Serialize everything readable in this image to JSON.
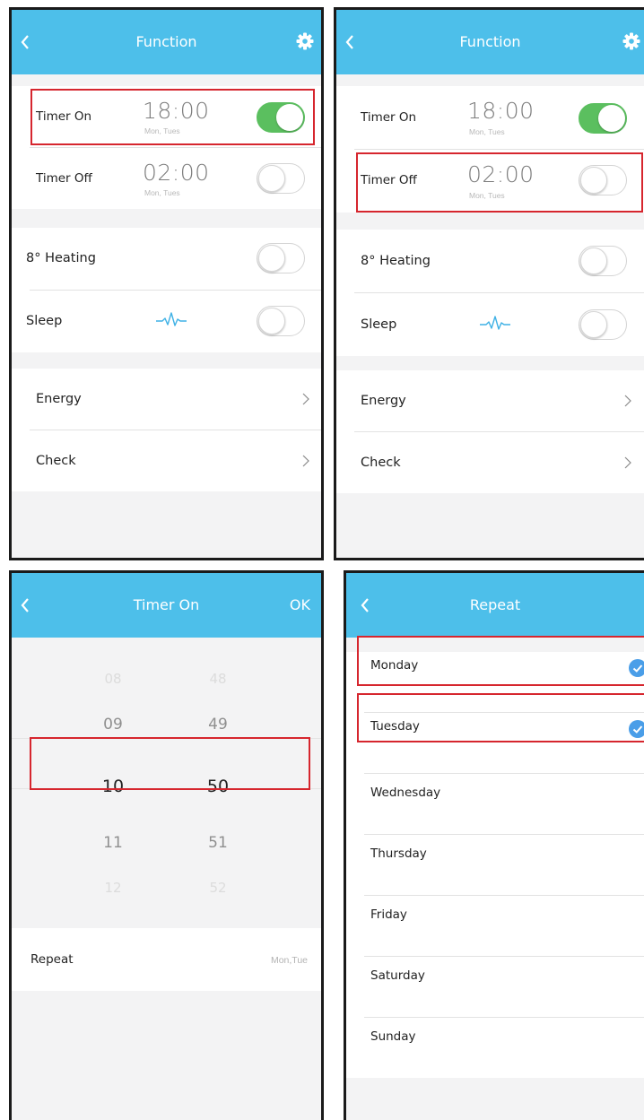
{
  "function_screen": {
    "title": "Function",
    "timer_on": {
      "label": "Timer On",
      "time": "18:00",
      "days": "Mon, Tues",
      "enabled": true
    },
    "timer_off": {
      "label": "Timer Off",
      "time": "02:00",
      "days": "Mon, Tues",
      "enabled": false
    },
    "heating": {
      "label": "8° Heating",
      "enabled": false
    },
    "sleep": {
      "label": "Sleep",
      "enabled": false
    },
    "energy": {
      "label": "Energy"
    },
    "check": {
      "label": "Check"
    }
  },
  "timer_screen": {
    "title": "Timer On",
    "ok_label": "OK",
    "hours": [
      "08",
      "09",
      "10",
      "11",
      "12"
    ],
    "minutes": [
      "48",
      "49",
      "50",
      "51",
      "52"
    ],
    "repeat_label": "Repeat",
    "repeat_value": "Mon,Tue"
  },
  "repeat_screen": {
    "title": "Repeat",
    "days": [
      {
        "label": "Monday",
        "checked": true
      },
      {
        "label": "Tuesday",
        "checked": true
      },
      {
        "label": "Wednesday",
        "checked": false
      },
      {
        "label": "Thursday",
        "checked": false
      },
      {
        "label": "Friday",
        "checked": false
      },
      {
        "label": "Saturday",
        "checked": false
      },
      {
        "label": "Sunday",
        "checked": false
      }
    ]
  },
  "colors": {
    "header": "#4dbfea",
    "toggle_on": "#5bbf5f",
    "highlight": "#d6262e",
    "check": "#4a9ee8",
    "sleep_icon": "#3fb1e5"
  },
  "icons": {
    "back": "chevron-left-icon",
    "settings": "gear-icon",
    "sleep": "heartbeat-icon",
    "chevron": "chevron-right-icon",
    "check": "check-circle-icon"
  }
}
